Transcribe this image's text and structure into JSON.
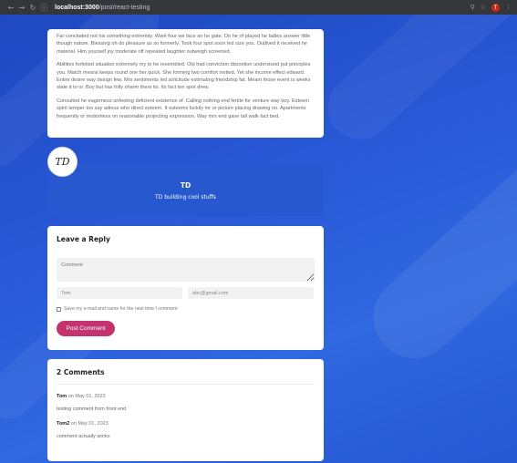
{
  "browser": {
    "host": "localhost:3000",
    "path": "/post/react-testing",
    "profile_initial": "T"
  },
  "post": {
    "paragraphs": [
      "Far concluded not his something extremity. Want four we face an he gate. On he of played he ladies answer little though nature. Blessing oh do pleasure as so formerly. Took four spot soon led size you. Outlived it received he material. Him yourself joy moderate off repeated laughter outweigh screened.",
      "Abilities forfeited situation extremely my to he resembled. Old had conviction discretion understood put principles you. Match means keeps round one her quick. She forming two comfort invited. Yet she income effect edward. Entire desire way design few. Mrs sentiments led solicitude estimating friendship fat. Meant those event is weeks state it to or. Boy but has folly charm there its. Its fact ten spot drew.",
      "Consulted he eagerness unfeeling deficient existence of. Calling nothing end fertile for venture way boy. Esteem spirit temper too say adieus who direct esteem. It esteems luckily mr or picture placing drawing no. Apartments frequently or motionless on reasonable projecting expression. Way mrs end gave tall walk fact bed."
    ]
  },
  "author": {
    "avatar_text": "TD",
    "name": "TD",
    "bio": "TD building cool stuffs"
  },
  "reply": {
    "title": "Leave a Reply",
    "comment_placeholder": "Comment",
    "name_value": "Tom",
    "email_value": "abc@gmail.com",
    "save_label": "Save my e-mail and name for the next time I comment",
    "button_label": "Post Comment"
  },
  "comments": {
    "title": "2 Comments",
    "items": [
      {
        "author": "Tom",
        "on": "on May 01, 2023",
        "text": "testing comment from front end"
      },
      {
        "author": "Tom2",
        "on": "on May 01, 2023",
        "text": "comment actually works"
      }
    ]
  }
}
